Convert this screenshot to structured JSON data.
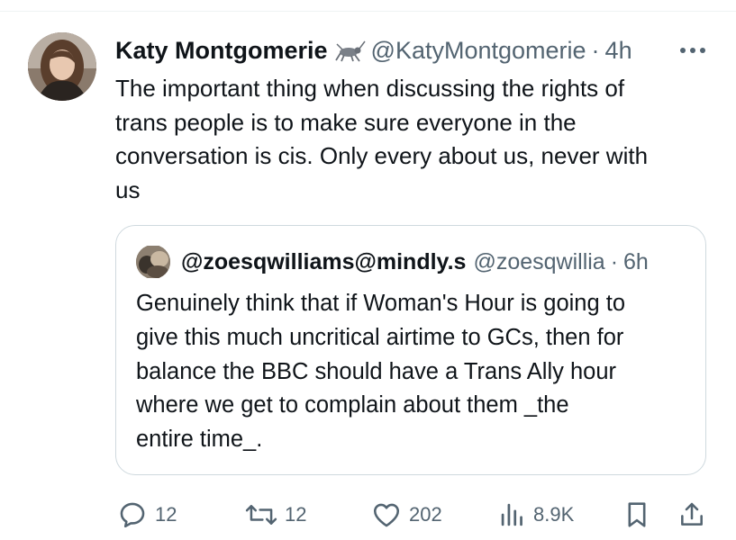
{
  "tweet": {
    "display_name": "Katy Montgomerie",
    "badge_icon": "cricket-icon",
    "handle": "@KatyMontgomerie",
    "separator": "·",
    "time": "4h",
    "more_icon": "more-dots-icon",
    "text": "The important thing when discussing the rights of\ntrans people is to make sure everyone in the\nconversation is cis. Only every about us, never with\nus"
  },
  "quote": {
    "display_name": "@zoesqwilliams@mindly.s",
    "handle": "@zoesqwillia",
    "separator": "·",
    "time": "6h",
    "text": "Genuinely think that if Woman's Hour is going to\ngive this much uncritical airtime to GCs, then for\nbalance the BBC should have a Trans Ally hour\nwhere we get to complain about them _the\nentire time_."
  },
  "actions": {
    "replies": "12",
    "retweets": "12",
    "likes": "202",
    "views": "8.9K"
  },
  "colors": {
    "text": "#0f1419",
    "secondary": "#536471",
    "border": "#cfd9de"
  }
}
